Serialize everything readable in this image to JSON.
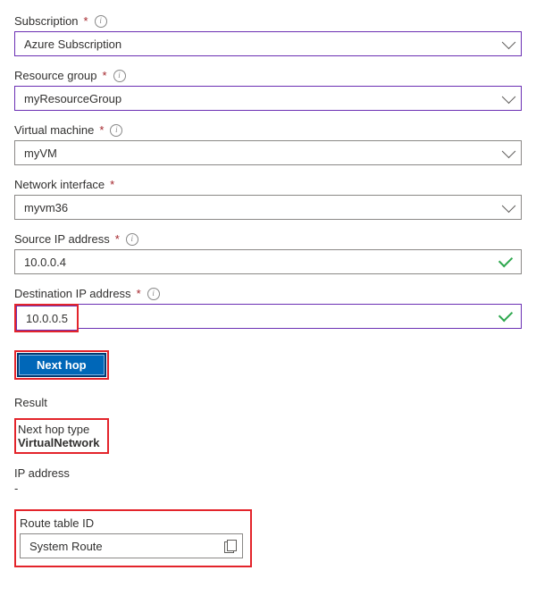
{
  "fields": {
    "subscription": {
      "label": "Subscription",
      "required": true,
      "info": true,
      "value": "Azure Subscription",
      "highlight": true
    },
    "resource_group": {
      "label": "Resource group",
      "required": true,
      "info": true,
      "value": "myResourceGroup",
      "highlight": true
    },
    "virtual_machine": {
      "label": "Virtual machine",
      "required": true,
      "info": true,
      "value": "myVM",
      "highlight": false
    },
    "network_interface": {
      "label": "Network interface",
      "required": true,
      "info": false,
      "value": "myvm36",
      "highlight": false
    },
    "source_ip": {
      "label": "Source IP address",
      "required": true,
      "info": true,
      "value": "10.0.0.4",
      "valid": true
    },
    "destination_ip": {
      "label": "Destination IP address",
      "required": true,
      "info": true,
      "value": "10.0.0.5",
      "valid": true
    }
  },
  "button": {
    "label": "Next hop"
  },
  "result": {
    "heading": "Result",
    "next_hop_type": {
      "label": "Next hop type",
      "value": "VirtualNetwork"
    },
    "ip_address": {
      "label": "IP address",
      "value": "-"
    },
    "route_table": {
      "label": "Route table ID",
      "value": "System Route"
    }
  },
  "required_marker": "*"
}
